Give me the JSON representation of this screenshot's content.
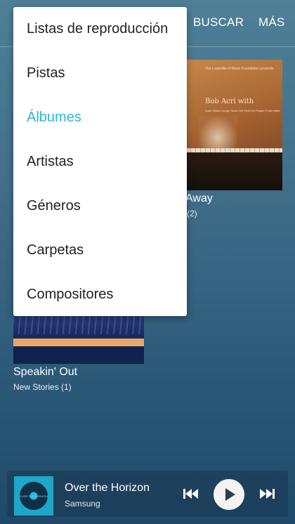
{
  "toolbar": {
    "search_label": "BUSCAR",
    "more_label": "MÁS"
  },
  "menu": {
    "items": [
      {
        "label": "Listas de reproducción",
        "selected": false
      },
      {
        "label": "Pistas",
        "selected": false
      },
      {
        "label": "Álbumes",
        "selected": true
      },
      {
        "label": "Artistas",
        "selected": false
      },
      {
        "label": "Géneros",
        "selected": false
      },
      {
        "label": "Carpetas",
        "selected": false
      },
      {
        "label": "Compositores",
        "selected": false
      }
    ],
    "selected_color": "#2bb8d6"
  },
  "albums": [
    {
      "title": "Away",
      "subtitle": "(2)",
      "cover": {
        "artist": "Bob Acri with",
        "small_text": "The Louisville of Music Foundation presents",
        "songs": "Dave Gibbs Lounge Stuck Jeff Stroll Old Flagler Frank Miller"
      }
    },
    {
      "title": "Speakin' Out",
      "subtitle": "New Stories  (1)"
    }
  ],
  "player": {
    "song": "Over the Horizon",
    "artist": "Samsung",
    "art_text": "OVER THE HORIZON",
    "state": "paused"
  },
  "colors": {
    "accent": "#2bb8d6",
    "background_top": "#4f7f97",
    "background_bottom": "#1f4a6a"
  }
}
